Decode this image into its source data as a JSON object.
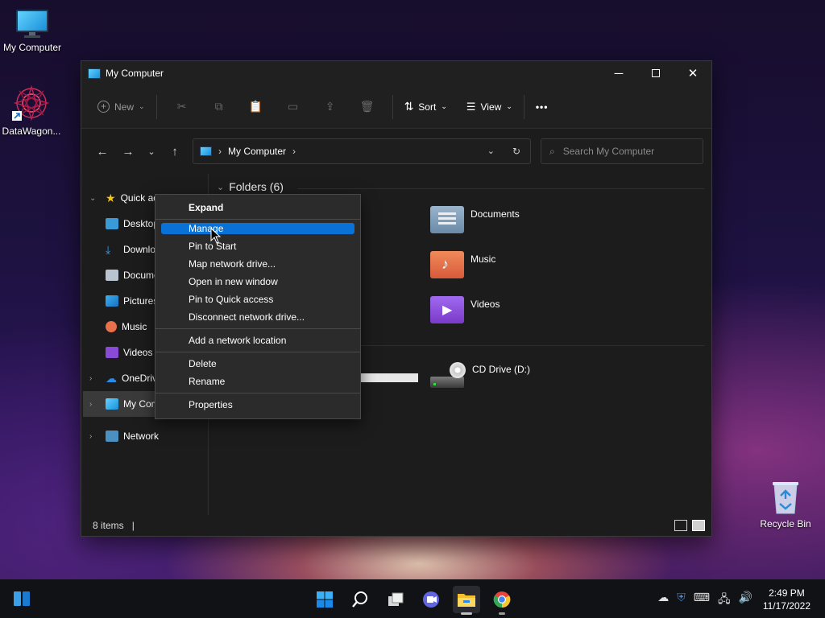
{
  "desktop": {
    "icons": [
      {
        "label": "My Computer",
        "icon": "monitor-icon"
      },
      {
        "label": "DataWagon...",
        "icon": "mandala-shortcut-icon"
      },
      {
        "label": "Recycle Bin",
        "icon": "recycle-bin-icon"
      }
    ]
  },
  "window": {
    "title": "My Computer",
    "toolbar": {
      "new_label": "New",
      "sort_label": "Sort",
      "view_label": "View",
      "more_label": "•••"
    },
    "address": {
      "crumb": "My Computer",
      "search_placeholder": "Search My Computer"
    },
    "sidebar": {
      "items": [
        {
          "label": "Quick access",
          "icon": "star-icon",
          "level": 0,
          "expanded": true
        },
        {
          "label": "Desktop",
          "icon": "desktop-folder-icon",
          "level": 1
        },
        {
          "label": "Downloads",
          "icon": "downloads-icon",
          "level": 1
        },
        {
          "label": "Documents",
          "icon": "documents-icon",
          "level": 1
        },
        {
          "label": "Pictures",
          "icon": "pictures-icon",
          "level": 1
        },
        {
          "label": "Music",
          "icon": "music-icon",
          "level": 1
        },
        {
          "label": "Videos",
          "icon": "videos-icon",
          "level": 1
        },
        {
          "label": "OneDrive",
          "icon": "cloud-icon",
          "level": 0
        },
        {
          "label": "My Computer",
          "icon": "monitor-icon",
          "level": 0,
          "selected": true
        },
        {
          "label": "Network",
          "icon": "network-icon",
          "level": 0
        }
      ]
    },
    "content": {
      "group_header": "Folders (6)",
      "folders": [
        {
          "label": "Documents",
          "icon": "documents-folder-icon",
          "color": "#7a9ab8"
        },
        {
          "label": "Music",
          "icon": "music-folder-icon",
          "color": "#e8704a"
        },
        {
          "label": "Videos",
          "icon": "videos-folder-icon",
          "color": "#8a4ad8"
        }
      ],
      "drive": {
        "label": "CD Drive (D:)",
        "icon": "cd-drive-icon"
      }
    },
    "status": {
      "items_count": "8 items"
    }
  },
  "context_menu": {
    "items": [
      {
        "label": "Expand",
        "bold": true
      },
      {
        "label": "Manage",
        "highlighted": true
      },
      {
        "label": "Pin to Start"
      },
      {
        "label": "Map network drive..."
      },
      {
        "label": "Open in new window"
      },
      {
        "label": "Pin to Quick access"
      },
      {
        "label": "Disconnect network drive..."
      },
      {
        "label": "Add a network location"
      },
      {
        "label": "Delete"
      },
      {
        "label": "Rename"
      },
      {
        "label": "Properties"
      }
    ]
  },
  "taskbar": {
    "apps": [
      "start-icon",
      "search-icon",
      "task-view-icon",
      "teams-chat-icon",
      "file-explorer-icon",
      "chrome-icon"
    ],
    "clock_time": "2:49 PM",
    "clock_date": "11/17/2022"
  },
  "colors": {
    "accent": "#0a72d6",
    "window_bg": "#1c1c1c",
    "menu_bg": "#2b2b2b"
  }
}
